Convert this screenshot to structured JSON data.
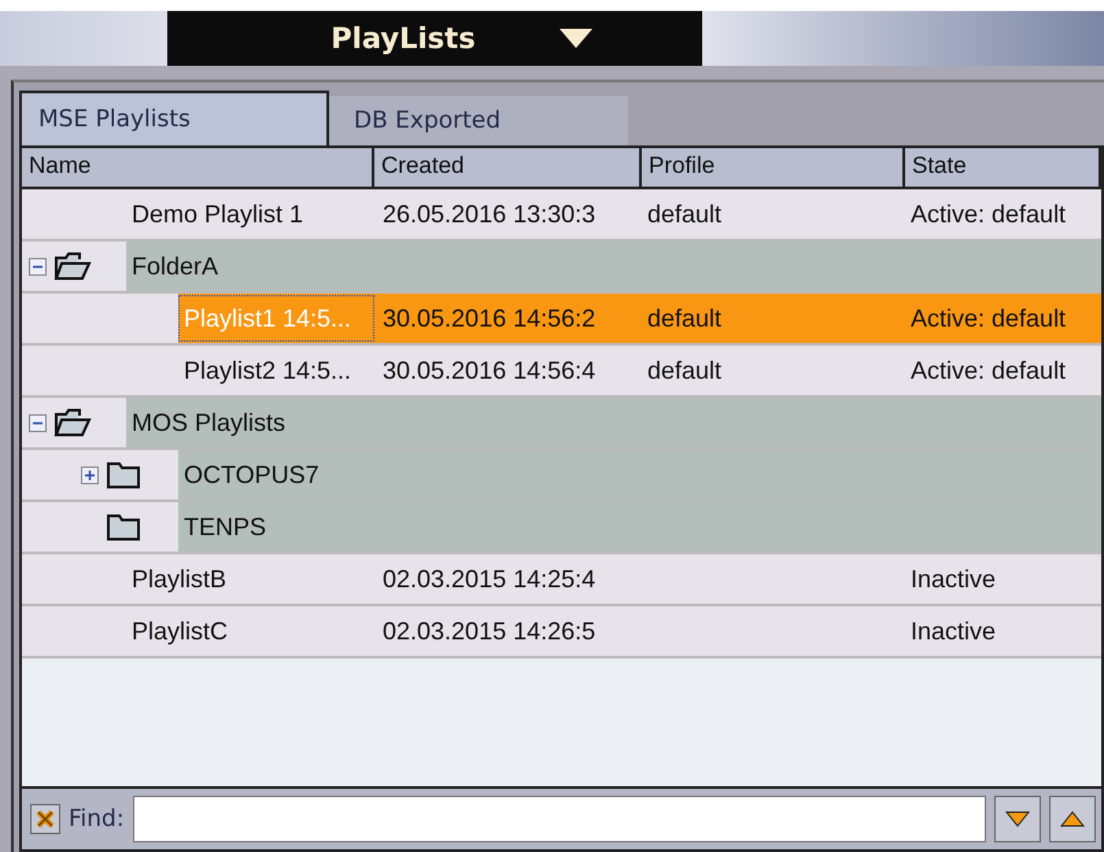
{
  "window": {
    "title": "PlayLists"
  },
  "tabs": [
    {
      "label": "MSE Playlists",
      "selected": true
    },
    {
      "label": "DB Exported",
      "selected": false
    }
  ],
  "table": {
    "columns": [
      "Name",
      "Created",
      "Profile",
      "State"
    ],
    "rows": [
      {
        "kind": "playlist",
        "name": "Demo Playlist 1",
        "created": "26.05.2016 13:30:3",
        "profile": "default",
        "state": "Active: default",
        "selected": false
      },
      {
        "kind": "folder",
        "name": "FolderA",
        "expanded": true,
        "children": [
          {
            "kind": "playlist",
            "name": "Playlist1 14:5...",
            "created": "30.05.2016 14:56:2",
            "profile": "default",
            "state": "Active: default",
            "selected": true
          },
          {
            "kind": "playlist",
            "name": "Playlist2 14:5...",
            "created": "30.05.2016 14:56:4",
            "profile": "default",
            "state": "Active: default",
            "selected": false
          }
        ]
      },
      {
        "kind": "folder",
        "name": "MOS Playlists",
        "expanded": true,
        "children": [
          {
            "kind": "folder",
            "name": "OCTOPUS7",
            "expanded": false
          },
          {
            "kind": "folder",
            "name": "TENPS"
          }
        ]
      },
      {
        "kind": "playlist",
        "name": "PlaylistB",
        "created": "02.03.2015 14:25:4",
        "state": "Inactive",
        "selected": false
      },
      {
        "kind": "playlist",
        "name": "PlaylistC",
        "created": "02.03.2015 14:26:5",
        "state": "Inactive",
        "selected": false
      }
    ]
  },
  "find": {
    "label": "Find:"
  }
}
